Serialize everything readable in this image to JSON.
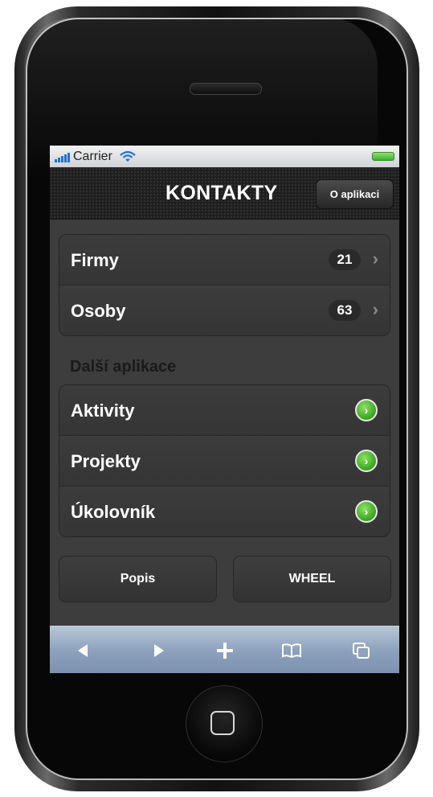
{
  "status_bar": {
    "carrier": "Carrier",
    "signal_icon": "signal-bars-icon",
    "wifi_icon": "wifi-icon",
    "battery_icon": "battery-icon"
  },
  "header": {
    "title": "KONTAKTY",
    "about_button": "O aplikaci"
  },
  "contacts": [
    {
      "label": "Firmy",
      "count": "21"
    },
    {
      "label": "Osoby",
      "count": "63"
    }
  ],
  "section_header": "Další aplikace",
  "apps": [
    {
      "label": "Aktivity"
    },
    {
      "label": "Projekty"
    },
    {
      "label": "Úkolovník"
    }
  ],
  "buttons": {
    "left": "Popis",
    "right": "WHEEL"
  },
  "toolbar_icons": [
    "back-icon",
    "forward-icon",
    "add-icon",
    "bookmarks-icon",
    "pages-icon"
  ],
  "colors": {
    "screen_background": "#3d3d3d",
    "go_icon_green": "#3aa21e",
    "toolbar_blue": "#8ea2bd"
  }
}
